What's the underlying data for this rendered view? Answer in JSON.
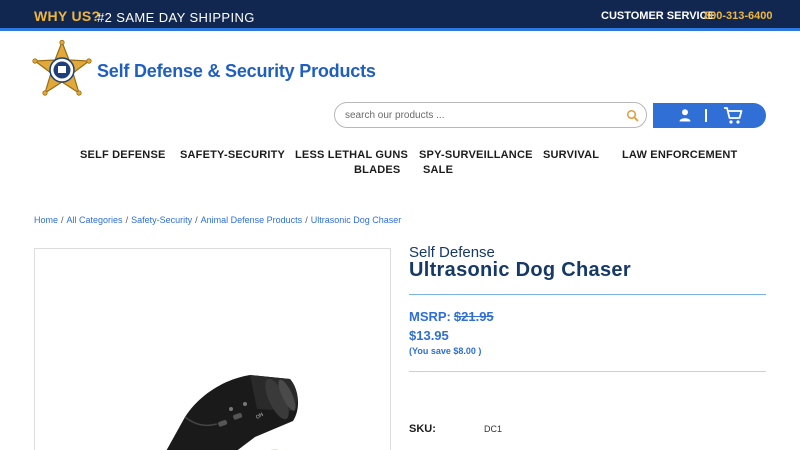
{
  "topbar": {
    "why_us": "WHY US?",
    "shipping": "#2 SAME DAY SHIPPING",
    "customer_service": "CUSTOMER SERVICE",
    "phone": "800-313-6400"
  },
  "brand": {
    "name": "Self Defense & Security Products"
  },
  "search": {
    "placeholder": "search our products ..."
  },
  "nav": {
    "items": [
      "SELF DEFENSE",
      "SAFETY-SECURITY",
      "LESS LETHAL GUNS",
      "SPY-SURVEILLANCE",
      "SURVIVAL",
      "LAW ENFORCEMENT",
      "BLADES",
      "SALE"
    ]
  },
  "breadcrumb": {
    "items": [
      "Home",
      "All Categories",
      "Safety-Security",
      "Animal Defense Products",
      "Ultrasonic Dog Chaser"
    ],
    "separator": "/"
  },
  "product": {
    "brand": "Self Defense",
    "title": "Ultrasonic Dog Chaser",
    "msrp_label": "MSRP:",
    "msrp_value": "$21.95",
    "price": "$13.95",
    "savings": "(You save $8.00 )",
    "sku_label": "SKU:",
    "sku_value": "DC1"
  },
  "colors": {
    "topbar_bg": "#12274f",
    "accent_gold": "#f0b63a",
    "brand_blue": "#1f5fc2",
    "button_blue": "#2f6fd6",
    "title_navy": "#173968"
  },
  "icons": {
    "logo": "sheriff-star-badge",
    "search": "magnifier-icon",
    "account": "user-icon",
    "cart": "cart-icon"
  }
}
